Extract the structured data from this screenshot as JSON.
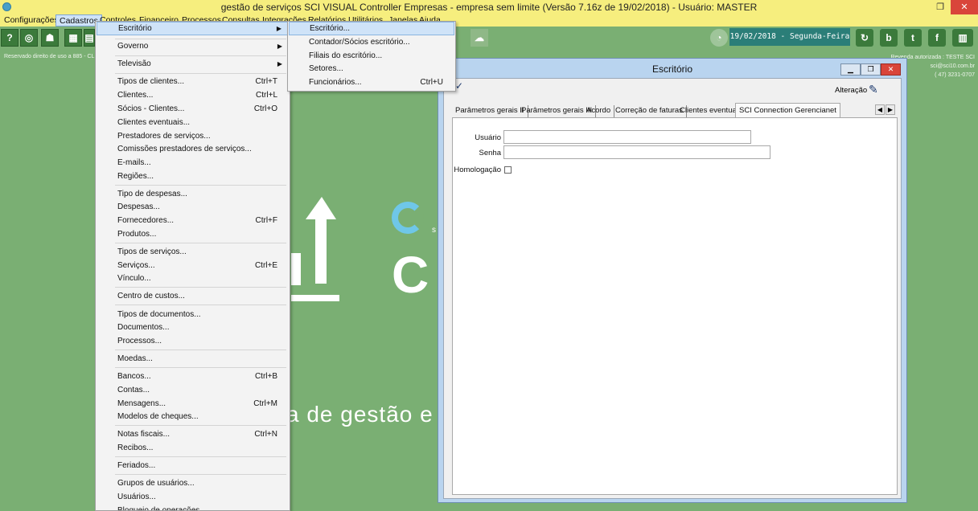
{
  "window": {
    "title": "gestão de serviços SCI VISUAL Controller Empresas - empresa sem limite (Versão 7.16z de 19/02/2018) - Usuário: MASTER",
    "min": "–",
    "restore": "❐",
    "close": "✕"
  },
  "menubar": [
    {
      "label": "Configurações"
    },
    {
      "label": "Cadastros"
    },
    {
      "label": "Controles"
    },
    {
      "label": "Financeiro"
    },
    {
      "label": "Processos"
    },
    {
      "label": "Consultas"
    },
    {
      "label": "Integrações"
    },
    {
      "label": "Relatórios"
    },
    {
      "label": "Utilitários"
    },
    {
      "label": "Janelas"
    },
    {
      "label": "Ajuda"
    }
  ],
  "toolbar": {
    "date": "19/02/2018 - Segunda-Feira",
    "reserved": "Reservado direito de uso a 885 - CL",
    "reseller_line1": "Revenda autorizada : TESTE SCI",
    "reseller_line2": "sci@sci10.com.br",
    "reseller_line3": "( 47) 3231-0707"
  },
  "background": {
    "slogan": "a de gestão e",
    "logo_letters": "C",
    "logo_small": "s"
  },
  "cadastros_menu": [
    {
      "label": "Escritório",
      "submenu": true
    },
    {
      "label": "Governo",
      "submenu": true
    },
    {
      "label": "Televisão",
      "submenu": true
    },
    {
      "label": "Tipos de clientes...",
      "shortcut": "Ctrl+T"
    },
    {
      "label": "Clientes...",
      "shortcut": "Ctrl+L"
    },
    {
      "label": "Sócios - Clientes...",
      "shortcut": "Ctrl+O"
    },
    {
      "label": "Clientes eventuais..."
    },
    {
      "label": "Prestadores de serviços..."
    },
    {
      "label": "Comissões prestadores de serviços..."
    },
    {
      "label": "E-mails..."
    },
    {
      "label": "Regiões..."
    },
    {
      "label": "Tipo de despesas..."
    },
    {
      "label": "Despesas..."
    },
    {
      "label": "Fornecedores...",
      "shortcut": "Ctrl+F"
    },
    {
      "label": "Produtos..."
    },
    {
      "label": "Tipos de serviços..."
    },
    {
      "label": "Serviços...",
      "shortcut": "Ctrl+E"
    },
    {
      "label": "Vínculo..."
    },
    {
      "label": "Centro de custos..."
    },
    {
      "label": "Tipos de documentos..."
    },
    {
      "label": "Documentos..."
    },
    {
      "label": "Processos..."
    },
    {
      "label": "Moedas..."
    },
    {
      "label": "Bancos...",
      "shortcut": "Ctrl+B"
    },
    {
      "label": "Contas..."
    },
    {
      "label": "Mensagens...",
      "shortcut": "Ctrl+M"
    },
    {
      "label": "Modelos de cheques..."
    },
    {
      "label": "Notas fiscais...",
      "shortcut": "Ctrl+N"
    },
    {
      "label": "Recibos..."
    },
    {
      "label": "Feriados..."
    },
    {
      "label": "Grupos de usuários..."
    },
    {
      "label": "Usuários..."
    },
    {
      "label": "Bloqueio de operações..."
    }
  ],
  "escritorio_submenu": [
    {
      "label": "Escritório..."
    },
    {
      "label": "Contador/Sócios escritório..."
    },
    {
      "label": "Filiais do escritório..."
    },
    {
      "label": "Setores..."
    },
    {
      "label": "Funcionários...",
      "shortcut": "Ctrl+U"
    }
  ],
  "child_window": {
    "title": "Escritório",
    "mode": "Alteração",
    "tabs": [
      {
        "label": "Parâmetros gerais II"
      },
      {
        "label": "Parâmetros gerais III"
      },
      {
        "label": "Acordo"
      },
      {
        "label": "Correção de faturas"
      },
      {
        "label": "Clientes eventuais"
      },
      {
        "label": "SCI Connection Gerencianet"
      }
    ],
    "fields": {
      "usuario_label": "Usuário",
      "usuario_value": "",
      "senha_label": "Senha",
      "senha_value": "",
      "homologacao_label": "Homologação"
    }
  }
}
